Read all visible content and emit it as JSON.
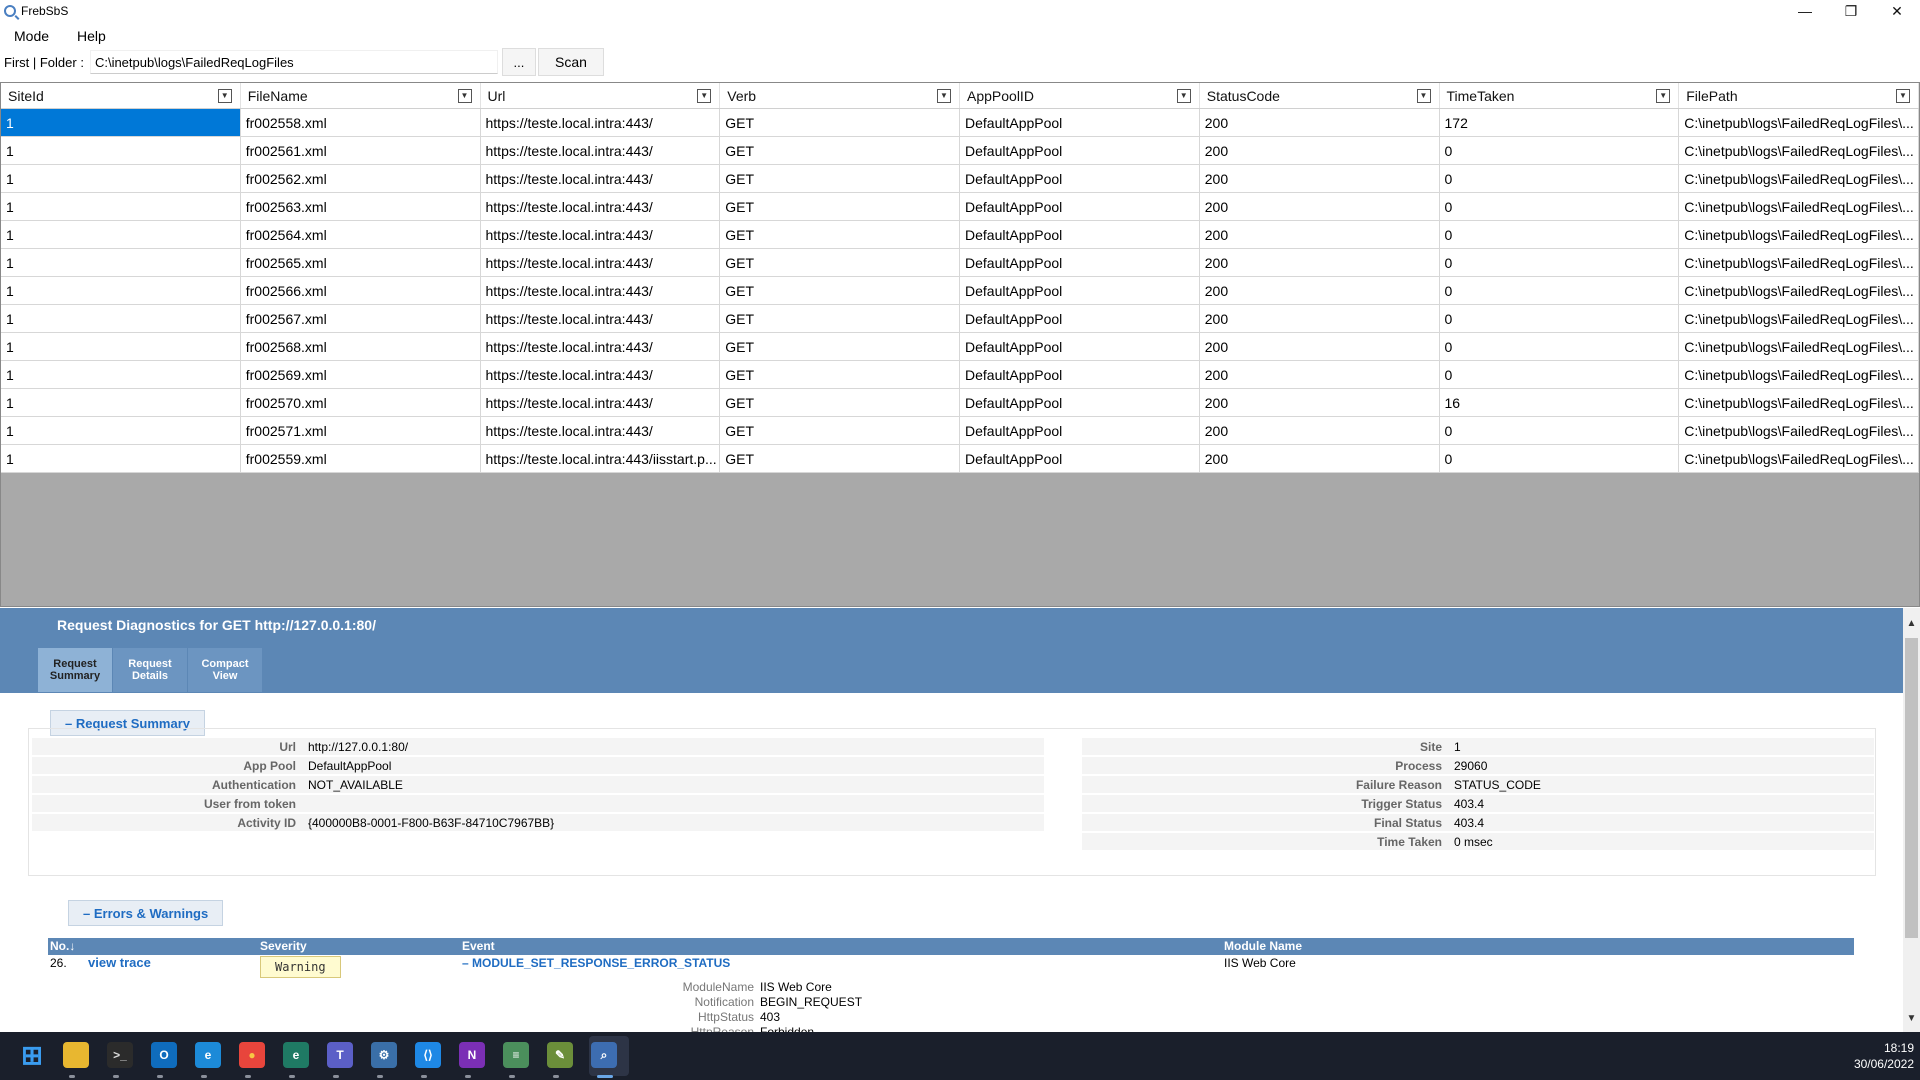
{
  "window": {
    "title": "FrebSbS",
    "controls": [
      "—",
      "❐",
      "✕"
    ]
  },
  "menu": [
    "Mode",
    "Help"
  ],
  "folder": {
    "label": "First | Folder :",
    "value": "C:\\inetpub\\logs\\FailedReqLogFiles",
    "browse_label": "...",
    "scan_label": "Scan"
  },
  "grid": {
    "columns": [
      "SiteId",
      "FileName",
      "Url",
      "Verb",
      "AppPoolID",
      "StatusCode",
      "TimeTaken",
      "FilePath"
    ],
    "rows": [
      [
        "1",
        "fr002558.xml",
        "https://teste.local.intra:443/",
        "GET",
        "DefaultAppPool",
        "200",
        "172",
        "C:\\inetpub\\logs\\FailedReqLogFiles\\..."
      ],
      [
        "1",
        "fr002561.xml",
        "https://teste.local.intra:443/",
        "GET",
        "DefaultAppPool",
        "200",
        "0",
        "C:\\inetpub\\logs\\FailedReqLogFiles\\..."
      ],
      [
        "1",
        "fr002562.xml",
        "https://teste.local.intra:443/",
        "GET",
        "DefaultAppPool",
        "200",
        "0",
        "C:\\inetpub\\logs\\FailedReqLogFiles\\..."
      ],
      [
        "1",
        "fr002563.xml",
        "https://teste.local.intra:443/",
        "GET",
        "DefaultAppPool",
        "200",
        "0",
        "C:\\inetpub\\logs\\FailedReqLogFiles\\..."
      ],
      [
        "1",
        "fr002564.xml",
        "https://teste.local.intra:443/",
        "GET",
        "DefaultAppPool",
        "200",
        "0",
        "C:\\inetpub\\logs\\FailedReqLogFiles\\..."
      ],
      [
        "1",
        "fr002565.xml",
        "https://teste.local.intra:443/",
        "GET",
        "DefaultAppPool",
        "200",
        "0",
        "C:\\inetpub\\logs\\FailedReqLogFiles\\..."
      ],
      [
        "1",
        "fr002566.xml",
        "https://teste.local.intra:443/",
        "GET",
        "DefaultAppPool",
        "200",
        "0",
        "C:\\inetpub\\logs\\FailedReqLogFiles\\..."
      ],
      [
        "1",
        "fr002567.xml",
        "https://teste.local.intra:443/",
        "GET",
        "DefaultAppPool",
        "200",
        "0",
        "C:\\inetpub\\logs\\FailedReqLogFiles\\..."
      ],
      [
        "1",
        "fr002568.xml",
        "https://teste.local.intra:443/",
        "GET",
        "DefaultAppPool",
        "200",
        "0",
        "C:\\inetpub\\logs\\FailedReqLogFiles\\..."
      ],
      [
        "1",
        "fr002569.xml",
        "https://teste.local.intra:443/",
        "GET",
        "DefaultAppPool",
        "200",
        "0",
        "C:\\inetpub\\logs\\FailedReqLogFiles\\..."
      ],
      [
        "1",
        "fr002570.xml",
        "https://teste.local.intra:443/",
        "GET",
        "DefaultAppPool",
        "200",
        "16",
        "C:\\inetpub\\logs\\FailedReqLogFiles\\..."
      ],
      [
        "1",
        "fr002571.xml",
        "https://teste.local.intra:443/",
        "GET",
        "DefaultAppPool",
        "200",
        "0",
        "C:\\inetpub\\logs\\FailedReqLogFiles\\..."
      ],
      [
        "1",
        "fr002559.xml",
        "https://teste.local.intra:443/iisstart.p...",
        "GET",
        "DefaultAppPool",
        "200",
        "0",
        "C:\\inetpub\\logs\\FailedReqLogFiles\\..."
      ]
    ]
  },
  "diagnostics": {
    "title": "Request Diagnostics for GET http://127.0.0.1:80/",
    "tabs": [
      {
        "line1": "Request",
        "line2": "Summary"
      },
      {
        "line1": "Request",
        "line2": "Details"
      },
      {
        "line1": "Compact",
        "line2": "View"
      }
    ],
    "summary_section": "– Request Summary",
    "left": [
      {
        "k": "Url",
        "v": "http://127.0.0.1:80/"
      },
      {
        "k": "App Pool",
        "v": "DefaultAppPool"
      },
      {
        "k": "Authentication",
        "v": "NOT_AVAILABLE"
      },
      {
        "k": "User from token",
        "v": ""
      },
      {
        "k": "Activity ID",
        "v": "{400000B8-0001-F800-B63F-84710C7967BB}"
      }
    ],
    "right": [
      {
        "k": "Site",
        "v": "1"
      },
      {
        "k": "Process",
        "v": "29060"
      },
      {
        "k": "Failure Reason",
        "v": "STATUS_CODE"
      },
      {
        "k": "Trigger Status",
        "v": "403.4"
      },
      {
        "k": "Final Status",
        "v": "403.4"
      },
      {
        "k": "Time Taken",
        "v": "0 msec"
      }
    ],
    "errors_section": "– Errors & Warnings",
    "errors_columns": [
      "No.↓",
      "Severity",
      "Event",
      "Module Name"
    ],
    "error": {
      "no": "26.",
      "link": "view trace",
      "severity": "Warning",
      "event": "– MODULE_SET_RESPONSE_ERROR_STATUS",
      "module": "IIS Web Core",
      "details": [
        {
          "k": "ModuleName",
          "v": "IIS Web Core"
        },
        {
          "k": "Notification",
          "v": "BEGIN_REQUEST"
        },
        {
          "k": "HttpStatus",
          "v": "403"
        },
        {
          "k": "HttpReason",
          "v": "Forbidden"
        }
      ]
    }
  },
  "taskbar": {
    "icons": [
      "windows-start-icon",
      "file-explorer-icon",
      "terminal-icon",
      "outlook-icon",
      "edge-icon",
      "chrome-icon",
      "edge-dev-icon",
      "teams-icon",
      "settings-icon",
      "vscode-icon",
      "onenote-icon",
      "notepad-icon",
      "tools-icon",
      "frebsbs-icon"
    ],
    "time": "18:19",
    "date": "30/06/2022"
  }
}
